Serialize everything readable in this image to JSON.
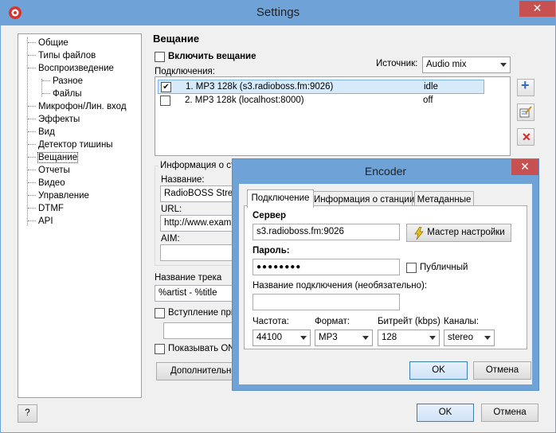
{
  "window": {
    "title": "Settings",
    "close_glyph": "✕"
  },
  "tree": {
    "items": [
      {
        "label": "Общие"
      },
      {
        "label": "Типы файлов"
      },
      {
        "label": "Воспроизведение"
      },
      {
        "label": "Разное"
      },
      {
        "label": "Файлы"
      },
      {
        "label": "Микрофон/Лин. вход"
      },
      {
        "label": "Эффекты"
      },
      {
        "label": "Вид"
      },
      {
        "label": "Детектор тишины"
      },
      {
        "label": "Вещание"
      },
      {
        "label": "Отчеты"
      },
      {
        "label": "Видео"
      },
      {
        "label": "Управление"
      },
      {
        "label": "DTMF"
      },
      {
        "label": "API"
      }
    ]
  },
  "broadcast": {
    "section_title": "Вещание",
    "enable_label": "Включить вещание",
    "source_label": "Источник:",
    "source_value": "Audio mix",
    "connections_label": "Подключения:",
    "connections": [
      {
        "name": "1. MP3 128k (s3.radioboss.fm:9026)",
        "status": "idle",
        "checked": "✔"
      },
      {
        "name": "2. MP3 128k (localhost:8000)",
        "status": "off",
        "checked": ""
      }
    ],
    "station_info_label": "Информация о ста",
    "name_label": "Название:",
    "name_value": "RadioBOSS Stream",
    "url_label": "URL:",
    "url_value": "http://www.exam",
    "aim_label": "AIM:",
    "aim_value": "",
    "track_title_label": "Название трека",
    "track_title_value": "%artist - %title",
    "intro_label": "Вступление при",
    "intro_value": "",
    "show_on_label": "Показывать ON",
    "additional_button": "Дополнительно"
  },
  "side_buttons": {
    "add_glyph": "+",
    "remove_glyph": "✕"
  },
  "footer": {
    "help_button": "?",
    "ok_button": "OK",
    "cancel_button": "Отмена"
  },
  "encoder": {
    "title": "Encoder",
    "close_glyph": "✕",
    "tabs": [
      {
        "label": "Подключение"
      },
      {
        "label": "Информация о станции"
      },
      {
        "label": "Метаданные"
      }
    ],
    "server_label": "Сервер",
    "server_value": "s3.radioboss.fm:9026",
    "wizard_button": "Мастер настройки",
    "password_label": "Пароль:",
    "password_value": "●●●●●●●●",
    "public_label": "Публичный",
    "connection_name_label": "Название подключения (необязательно):",
    "connection_name_value": "",
    "frequency_label": "Частота:",
    "frequency_value": "44100",
    "format_label": "Формат:",
    "format_value": "MP3",
    "bitrate_label": "Битрейт (kbps)",
    "bitrate_value": "128",
    "channels_label": "Каналы:",
    "channels_value": "stereo",
    "ok_button": "OK",
    "cancel_button": "Отмена"
  }
}
